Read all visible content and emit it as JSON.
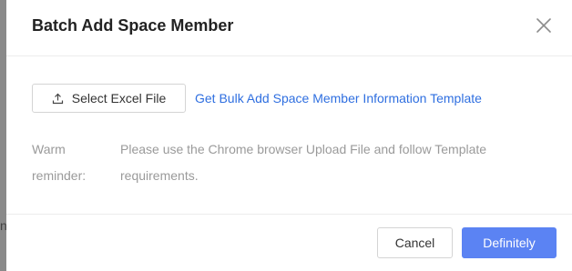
{
  "background": {
    "left_edge_char": "n"
  },
  "dialog": {
    "title": "Batch Add Space Member",
    "close_icon": "close-icon",
    "select_file_label": "Select Excel File",
    "upload_icon": "upload-icon",
    "template_link": "Get Bulk Add Space Member Information Template",
    "reminder_label": "Warm reminder:",
    "reminder_text": "Please use the Chrome browser Upload File and follow Template requirements.",
    "cancel_label": "Cancel",
    "confirm_label": "Definitely"
  },
  "colors": {
    "accent": "#5b83f3",
    "link": "#2f6fe0",
    "muted_text": "#9a9a9a",
    "title_text": "#222222"
  }
}
